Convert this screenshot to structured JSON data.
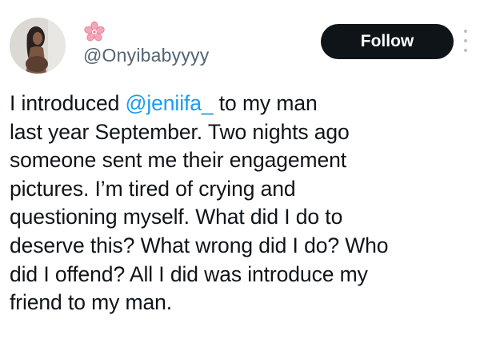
{
  "tweet": {
    "author": {
      "display_name_icon": "cherry-blossom-icon",
      "handle": "@Onyibabyyyy",
      "avatar": "avatar"
    },
    "follow_label": "Follow",
    "more_icon": "more-options-icon",
    "lines": [
      {
        "before": "I introduced ",
        "mention": "@jeniifa_",
        "after": " to my man"
      },
      {
        "text": "last year September. Two nights ago"
      },
      {
        "text": "someone sent me their engagement"
      },
      {
        "text": "pictures. I’m tired of crying and"
      },
      {
        "text": "questioning myself. What did I do to"
      },
      {
        "text": "deserve this? What wrong did I do? Who"
      },
      {
        "text": "did I offend? All I did was introduce my"
      },
      {
        "text": "friend to my man."
      }
    ]
  },
  "colors": {
    "link": "#1d9bf0",
    "text": "#0f1419",
    "handle": "#536471",
    "button_bg": "#0f1419",
    "button_text": "#ffffff",
    "blossom": "#f4a6b8"
  }
}
